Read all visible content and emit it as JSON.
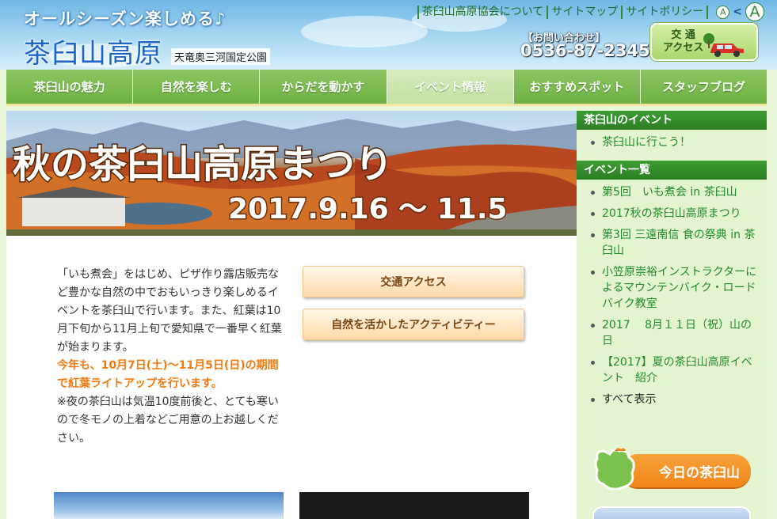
{
  "header": {
    "tagline": "オールシーズン楽しめる♪",
    "title": "茶臼山高原",
    "subtitle": "天竜奥三河国定公園",
    "top_links": [
      "茶臼山高原協会について",
      "サイトマップ",
      "サイトポリシー"
    ],
    "font_size": {
      "small": "A",
      "separator": "<",
      "large": "A"
    },
    "contact_label": "【お問い合わせ】",
    "contact_phone": "0536-87-2345",
    "access_button": "交 通\nアクセス"
  },
  "main_nav": {
    "items": [
      "茶臼山の魅力",
      "自然を楽しむ",
      "からだを動かす",
      "イベント情報",
      "おすすめスポット",
      "スタッフブログ"
    ],
    "active": "イベント情報"
  },
  "banner": {
    "title": "秋の茶臼山高原まつり",
    "dates": "2017.9.16 ～ 11.5"
  },
  "intro": {
    "paragraph1": "「いも煮会」をはじめ、ピザ作り露店販売など豊かな自然の中でおもいっきり楽しめるイベントを茶臼山で行います。また、紅葉は10月下旬から11月上旬で愛知県で一番早く紅葉が始まります。",
    "highlight": "今年も、10月7日(土)～11月5日(日)の期間で紅葉ライトアップを行います。",
    "note": "※夜の茶臼山は気温10度前後と、とても寒いので冬モノの上着などご用意の上お越しください。"
  },
  "buttons": {
    "access": "交通アクセス",
    "activity": "自然を活かしたアクティビティー"
  },
  "sidebar": {
    "section1_title": "茶臼山のイベント",
    "section1_items": [
      "茶臼山に行こう！"
    ],
    "section2_title": "イベント一覧",
    "section2_items": [
      "第5回　いも煮会 in 茶臼山",
      "2017秋の茶臼山高原まつり",
      "第3回 三遠南信 食の祭典 in 茶臼山",
      "小笠原崇裕インストラクターによるマウンテンバイク・ロードバイク教室",
      "2017　 8月１１日（祝）山の日",
      "【2017】夏の茶臼山高原イベント　紹介"
    ],
    "show_all": "すべて表示",
    "today_label": "今日の茶臼山"
  },
  "colors": {
    "nav_green": "#7bbb4f",
    "nav_active": "#c9e4aa",
    "sidebar_header": "#2f8a2a",
    "link_green": "#1e8a28",
    "highlight_orange": "#f07a10",
    "button_text": "#7a4510"
  },
  "icons": {
    "access_button": "car-icon",
    "today_banner": "mascot-icon"
  }
}
